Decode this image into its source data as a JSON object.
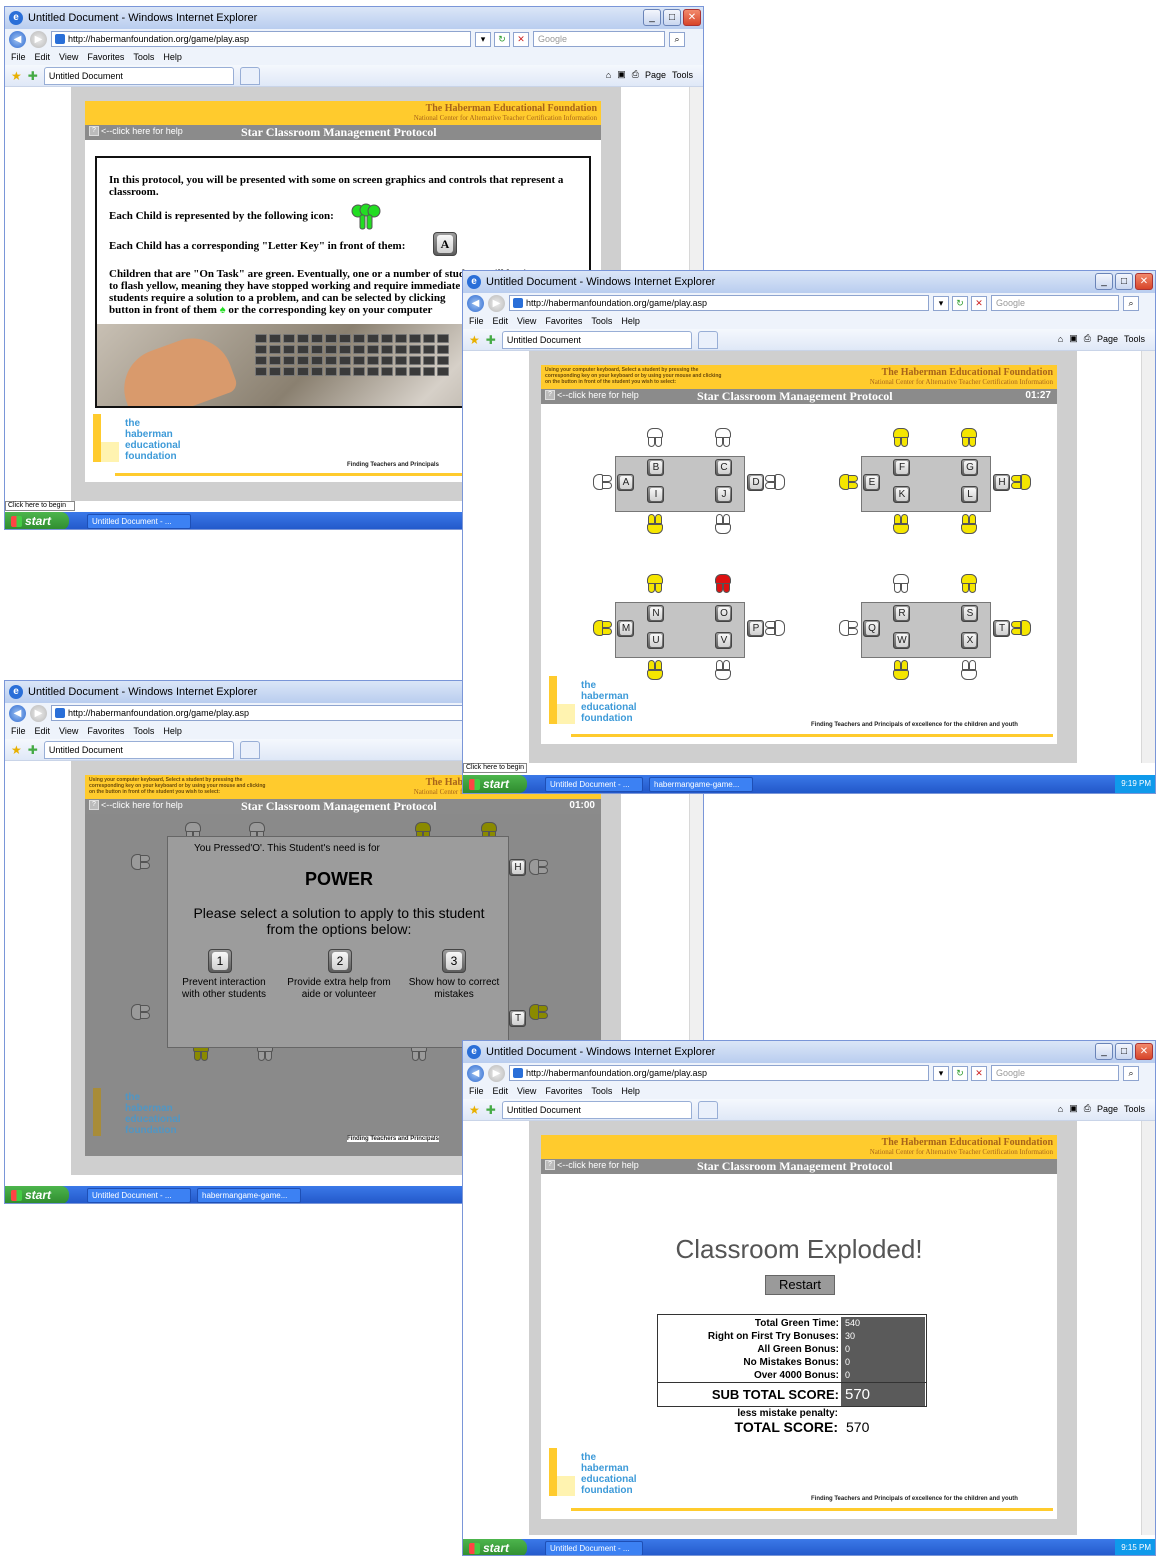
{
  "browser": {
    "window_title": "Untitled Document - Windows Internet Explorer",
    "url": "http://habermanfoundation.org/game/play.asp",
    "search_placeholder": "Google",
    "menu": [
      "File",
      "Edit",
      "View",
      "Favorites",
      "Tools",
      "Help"
    ],
    "tab_label": "Untitled Document",
    "page_menu": "Page",
    "tools_menu": "Tools",
    "status_text": "Click here to begin"
  },
  "taskbar": {
    "start_label": "start",
    "item_doc": "Untitled Document - ...",
    "item_game": "habermangame-game...",
    "clock_1": "9:19 PM",
    "clock_2": "9:15 PM"
  },
  "game": {
    "org_name": "The Haberman Educational Foundation",
    "org_sub": "National Center for Alternative Teacher Certification Information",
    "help_link": "<--click here for help",
    "protocol_title": "Star Classroom Management Protocol",
    "instructions_small": "Using your computer keyboard, Select a student by pressing the corresponding key on your keyboard or by using your mouse and clicking on the button in front of the student you wish to select:",
    "logo_lines": [
      "the",
      "haberman",
      "educational",
      "foundation"
    ],
    "tagline": "Finding Teachers and Principals of excellence for the children and youth",
    "tagline_short": "Finding Teachers and Principals"
  },
  "intro": {
    "p1": "In this protocol, you will be presented with some on screen graphics and controls that represent a classroom.",
    "p2": "Each Child is represented by the following icon:",
    "p3": "Each Child has a corresponding \"Letter Key\" in front of them:",
    "key_example": "A",
    "p4a": "Children that are \"On Task\" are green.  Eventually, one or a number of students will begin",
    "p4b": "to flash yellow, meaning they have stopped working and require immediate",
    "p4c": "students require a solution to a problem, and can be selected by clicking",
    "p4d": "button in front of them",
    "p4e": "or the corresponding key on your computer"
  },
  "classroom": {
    "timer": "01:27",
    "keys": [
      "A",
      "B",
      "C",
      "D",
      "E",
      "F",
      "G",
      "H",
      "I",
      "J",
      "K",
      "L",
      "M",
      "N",
      "O",
      "P",
      "Q",
      "R",
      "S",
      "T",
      "U",
      "V",
      "W",
      "X"
    ]
  },
  "popup": {
    "timer": "01:00",
    "pressed_text": "You Pressed'O'. This Student's need is for",
    "need": "POWER",
    "prompt": "Please select a solution to apply to this student from the options below:",
    "options": [
      {
        "key": "1",
        "label": "Prevent interaction with other students"
      },
      {
        "key": "2",
        "label": "Provide extra help from aide or volunteer"
      },
      {
        "key": "3",
        "label": "Show how to correct mistakes"
      }
    ],
    "bg_keys": [
      "H",
      "T"
    ]
  },
  "result": {
    "headline": "Classroom Exploded!",
    "restart": "Restart",
    "rows": [
      {
        "label": "Total Green Time:",
        "value": "540"
      },
      {
        "label": "Right on First Try Bonuses:",
        "value": "30"
      },
      {
        "label": "All Green Bonus:",
        "value": "0"
      },
      {
        "label": "No Mistakes Bonus:",
        "value": "0"
      },
      {
        "label": "Over 4000 Bonus:",
        "value": "0"
      }
    ],
    "subtotal_label": "SUB TOTAL SCORE:",
    "subtotal_value": "570",
    "penalty_label": "less mistake penalty:",
    "total_label": "TOTAL SCORE:",
    "total_value": "570"
  },
  "colors": {
    "on_task": "#22dd22",
    "flashing": "#f5e600",
    "need_help": "#dd1111",
    "idle": "#ffffff",
    "brand_yellow": "#ffcb2d"
  }
}
